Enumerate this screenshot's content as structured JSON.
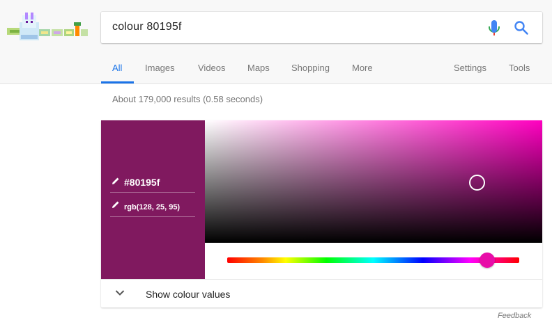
{
  "search": {
    "query": "colour 80195f"
  },
  "tabs": [
    {
      "label": "All"
    },
    {
      "label": "Images"
    },
    {
      "label": "Videos"
    },
    {
      "label": "Maps"
    },
    {
      "label": "Shopping"
    },
    {
      "label": "More"
    },
    {
      "label": "Settings"
    },
    {
      "label": "Tools"
    }
  ],
  "results": {
    "stats": "About 179,000 results (0.58 seconds)"
  },
  "color_picker": {
    "hex": "#80195f",
    "rgb": "rgb(128, 25, 95)",
    "hue_color": "#ff00c0",
    "hue_fraction": 0.89,
    "expander_label": "Show colour values"
  },
  "feedback": "Feedback",
  "colors": {
    "accent": "#1a73e8",
    "swatch": "#80195f",
    "thumb": "#e80da8"
  },
  "icons": [
    "doodle-logo",
    "mic-icon",
    "search-icon",
    "pencil-icon",
    "chevron-down-icon"
  ]
}
